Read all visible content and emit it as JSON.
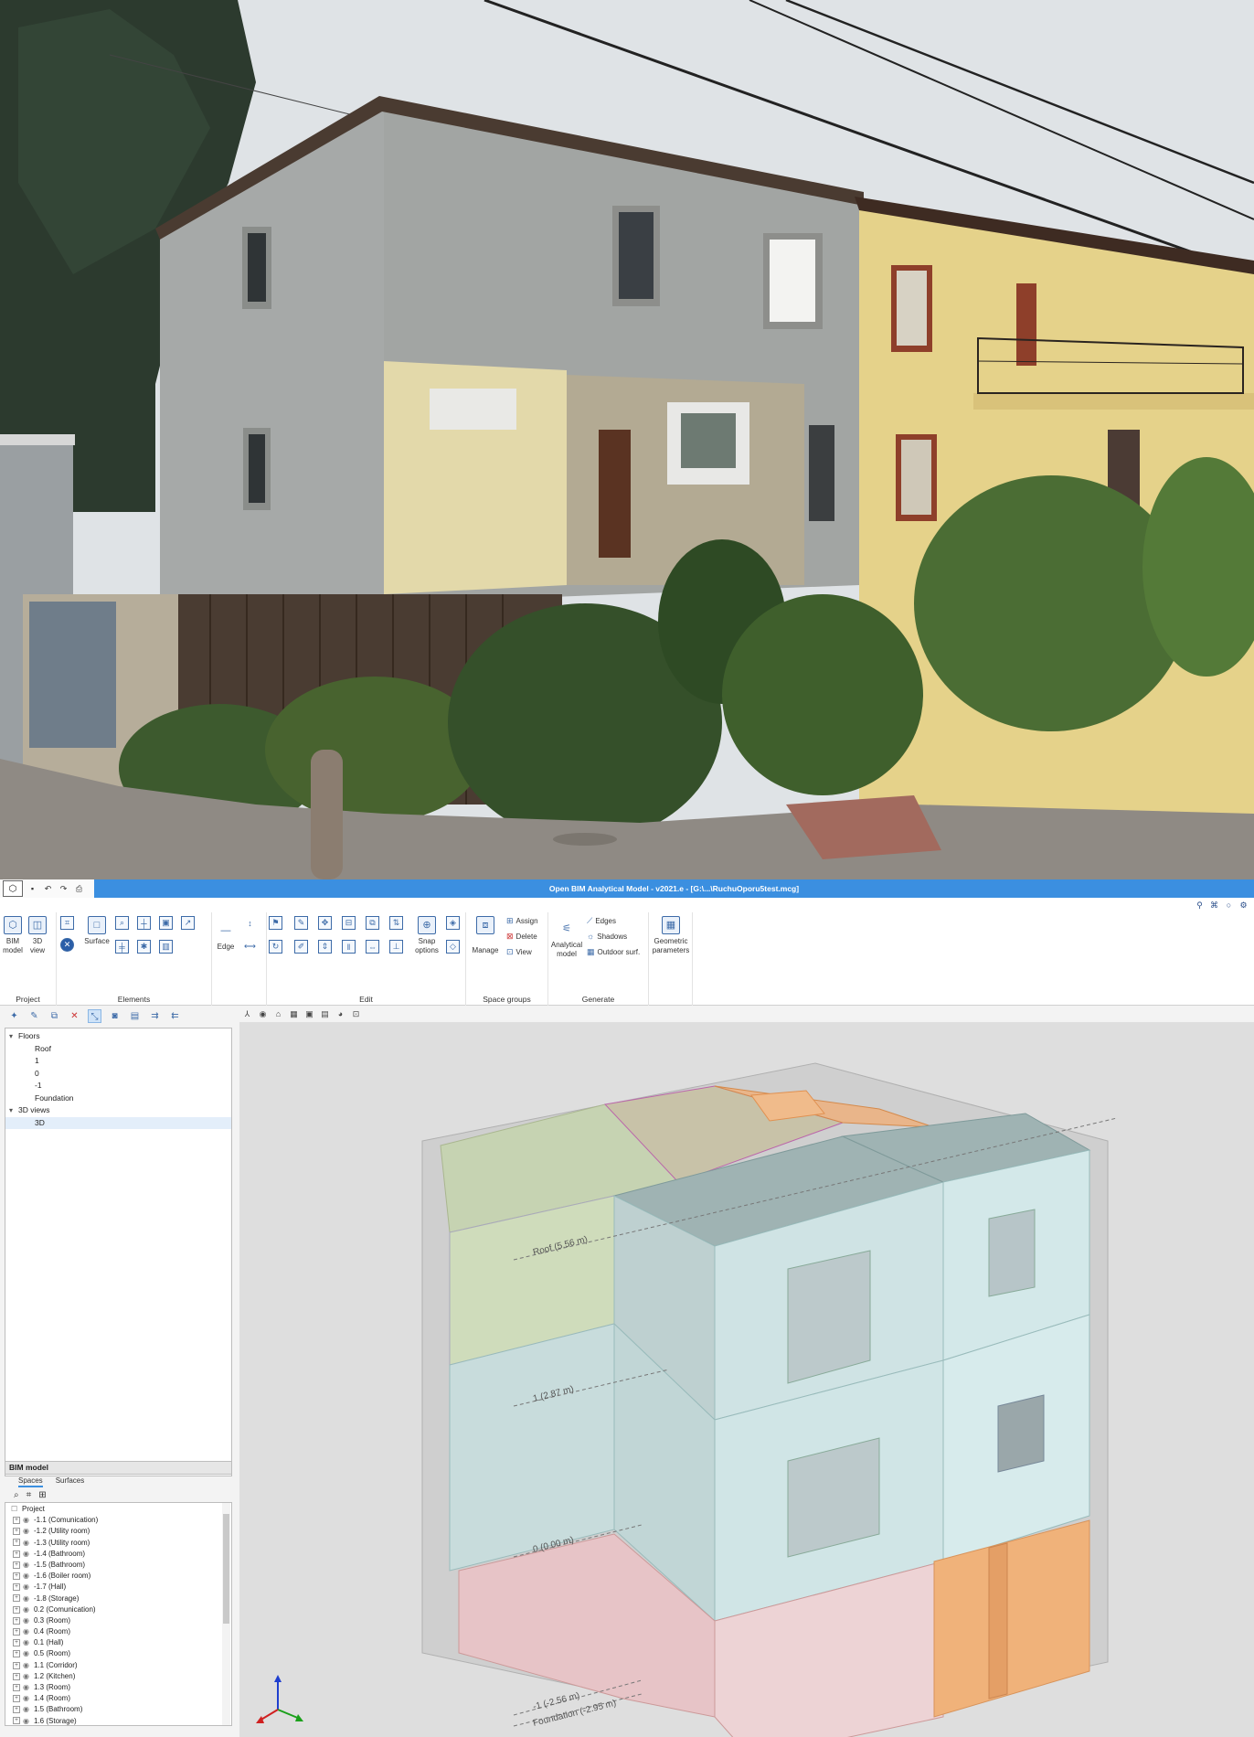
{
  "window": {
    "title": "Open BIM Analytical Model - v2021.e - [G:\\...\\RuchuOporu5test.mcg]",
    "quick_access": [
      "save-icon",
      "undo-icon",
      "redo-icon",
      "print-icon"
    ]
  },
  "ribbon": {
    "groups": [
      {
        "name": "Project",
        "buttons": [
          "BIM model",
          "3D view"
        ]
      },
      {
        "name": "Elements",
        "buttons": [
          "Surface",
          "Edge"
        ]
      },
      {
        "name": "Edit",
        "buttons": [
          "Snap options"
        ]
      },
      {
        "name": "Space groups",
        "buttons": [
          "Manage",
          "Assign",
          "Delete",
          "View"
        ]
      },
      {
        "name": "Generate",
        "buttons": [
          "Analytical model",
          "Edges",
          "Shadows",
          "Outdoor surf."
        ]
      },
      {
        "name": "",
        "buttons": [
          "Geometric parameters"
        ]
      }
    ],
    "bim_model": "BIM\nmodel",
    "view_3d": "3D\nview",
    "surface": "Surface",
    "edge": "Edge",
    "snap_options": "Snap\noptions",
    "manage": "Manage",
    "assign": "Assign",
    "delete": "Delete",
    "view": "View",
    "analytical_model": "Analytical\nmodel",
    "edges": "Edges",
    "shadows": "Shadows",
    "outdoor": "Outdoor surf.",
    "geometric": "Geometric\nparameters",
    "project_label": "Project",
    "elements_label": "Elements",
    "edit_label": "Edit",
    "space_groups_label": "Space groups",
    "generate_label": "Generate"
  },
  "floors_tree": {
    "floors_header": "Floors",
    "floors": [
      "Roof",
      "1",
      "0",
      "-1",
      "Foundation"
    ],
    "views_header": "3D views",
    "views": [
      "3D"
    ]
  },
  "bim_panel": {
    "title": "BIM model",
    "tabs": [
      "Spaces",
      "Surfaces"
    ],
    "root": "Project",
    "spaces": [
      "-1.1 (Comunication)",
      "-1.2 (Utility room)",
      "-1.3 (Utility room)",
      "-1.4 (Bathroom)",
      "-1.5 (Bathroom)",
      "-1.6 (Boiler room)",
      "-1.7 (Hall)",
      "-1.8 (Storage)",
      "0.2 (Comunication)",
      "0.3 (Room)",
      "0.4 (Room)",
      "0.1 (Hall)",
      "0.5 (Room)",
      "1.1 (Corridor)",
      "1.2 (Kitchen)",
      "1.3 (Room)",
      "1.4 (Room)",
      "1.5 (Bathroom)",
      "1.6 (Storage)"
    ]
  },
  "viewport": {
    "level_labels": [
      "Roof (5.56 m)",
      "1 (2.87 m)",
      "0 (0.00 m)",
      "-1 (-2.56 m)",
      "Foundation (-2.95 m)"
    ]
  },
  "colors": {
    "title_bar": "#3b8fe0",
    "accent": "#3d6ba8",
    "space_cyan": "#cfe6e8",
    "space_pink": "#e9c8cb",
    "space_orange": "#f0b07a",
    "space_green": "#c9d6b6"
  }
}
